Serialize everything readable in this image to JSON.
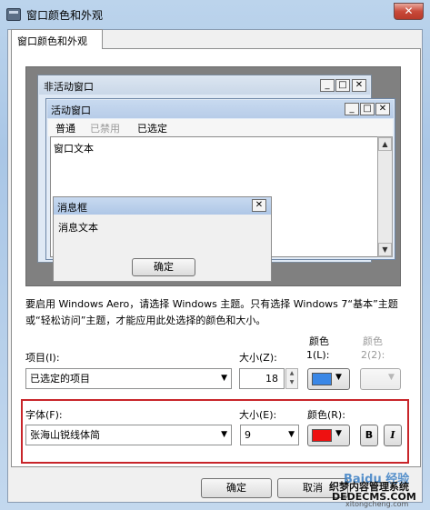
{
  "window": {
    "title": "窗口颜色和外观",
    "close_glyph": "✕"
  },
  "tab": {
    "label": "窗口颜色和外观"
  },
  "preview": {
    "inactive_title": "非活动窗口",
    "active_title": "活动窗口",
    "menu": [
      "普通",
      "已禁用",
      "已选定"
    ],
    "window_text": "窗口文本",
    "msgbox_title": "消息框",
    "msgbox_text": "消息文本",
    "msgbox_ok": "确定",
    "min_glyph": "_",
    "max_glyph": "□",
    "close_glyph": "✕"
  },
  "info": "要启用 Windows Aero，请选择 Windows 主题。只有选择 Windows 7“基本”主题或“轻松访问”主题，才能应用此处选择的颜色和大小。",
  "item": {
    "label": "项目(I):",
    "value": "已选定的项目",
    "size_label": "大小(Z):",
    "size_value": "18",
    "color1_label_a": "颜色",
    "color1_label_b": "1(L):",
    "color1": "#3a87e6",
    "color2_label_a": "颜色",
    "color2_label_b": "2(2):"
  },
  "font": {
    "label": "字体(F):",
    "value": "张海山锐线体简",
    "size_label": "大小(E):",
    "size_value": "9",
    "color_label": "颜色(R):",
    "color": "#ee1111",
    "bold": "B",
    "italic": "I"
  },
  "buttons": {
    "ok": "确定",
    "cancel": "取消"
  },
  "watermark": {
    "line1": "Baidu 经验",
    "line2": "织梦内容管理系统",
    "line3": "DEDECMS.COM",
    "line4": "xitongcheng.com"
  }
}
